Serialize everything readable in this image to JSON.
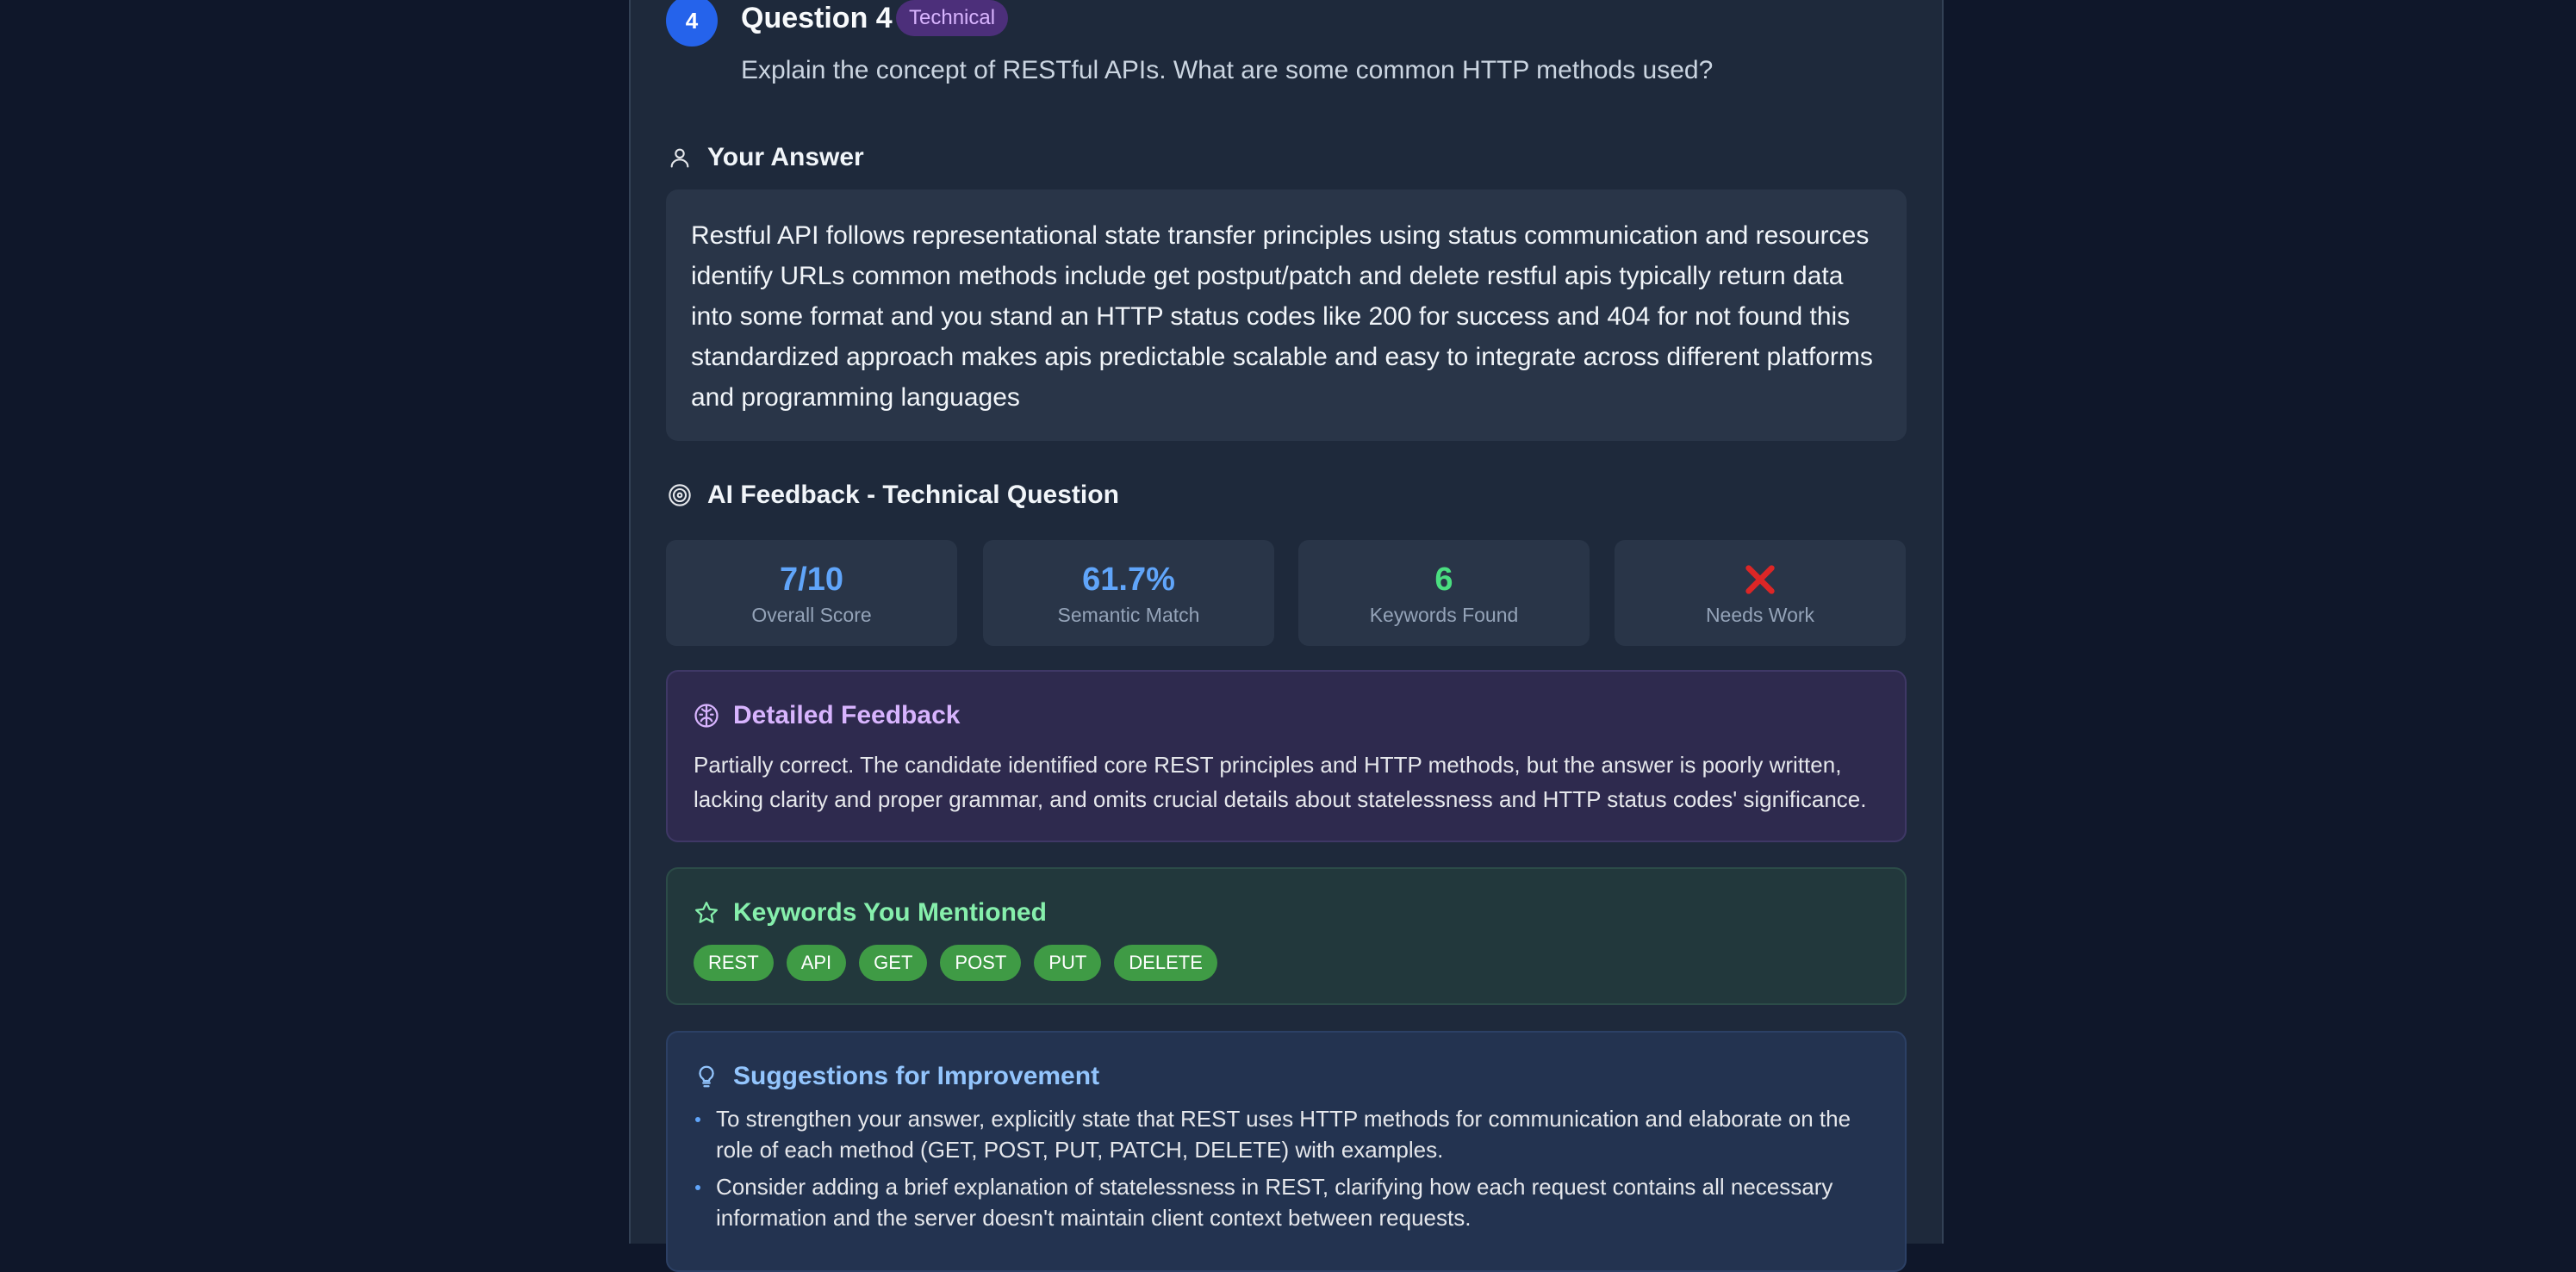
{
  "question": {
    "number": "4",
    "title": "Question 4",
    "badge": "Technical",
    "text": "Explain the concept of RESTful APIs. What are some common HTTP methods used?"
  },
  "answer": {
    "heading": "Your Answer",
    "text": "Restful API follows representational state transfer principles using status communication and resources identify URLs common methods include get postput/patch and delete restful apis typically return data into some format and you stand an HTTP status codes like 200 for success and 404 for not found this standardized approach makes apis predictable scalable and easy to integrate across different platforms and programming languages"
  },
  "feedback": {
    "heading": "AI Feedback - Technical Question",
    "stats": [
      {
        "value": "7/10",
        "label": "Overall Score",
        "color": "#60a5fa"
      },
      {
        "value": "61.7%",
        "label": "Semantic Match",
        "color": "#60a5fa"
      },
      {
        "value": "6",
        "label": "Keywords Found",
        "color": "#4ade80"
      },
      {
        "value": "",
        "label": "Needs Work",
        "color": "#dc2626",
        "icon": "x-icon"
      }
    ],
    "detailed": {
      "heading": "Detailed Feedback",
      "text": "Partially correct. The candidate identified core REST principles and HTTP methods, but the answer is poorly written, lacking clarity and proper grammar, and omits crucial details about statelessness and HTTP status codes' significance."
    },
    "keywords": {
      "heading": "Keywords You Mentioned",
      "items": [
        "REST",
        "API",
        "GET",
        "POST",
        "PUT",
        "DELETE"
      ]
    },
    "suggestions": {
      "heading": "Suggestions for Improvement",
      "items": [
        "To strengthen your answer, explicitly state that REST uses HTTP methods for communication and elaborate on the role of each method (GET, POST, PUT, PATCH, DELETE) with examples.",
        "Consider adding a brief explanation of statelessness in REST, clarifying how each request contains all necessary information and the server doesn't maintain client context between requests."
      ]
    }
  },
  "colors": {
    "accent": "#2563eb",
    "badge_bg": "#4c2f7a",
    "keyword_tag": "#3f9b45"
  }
}
